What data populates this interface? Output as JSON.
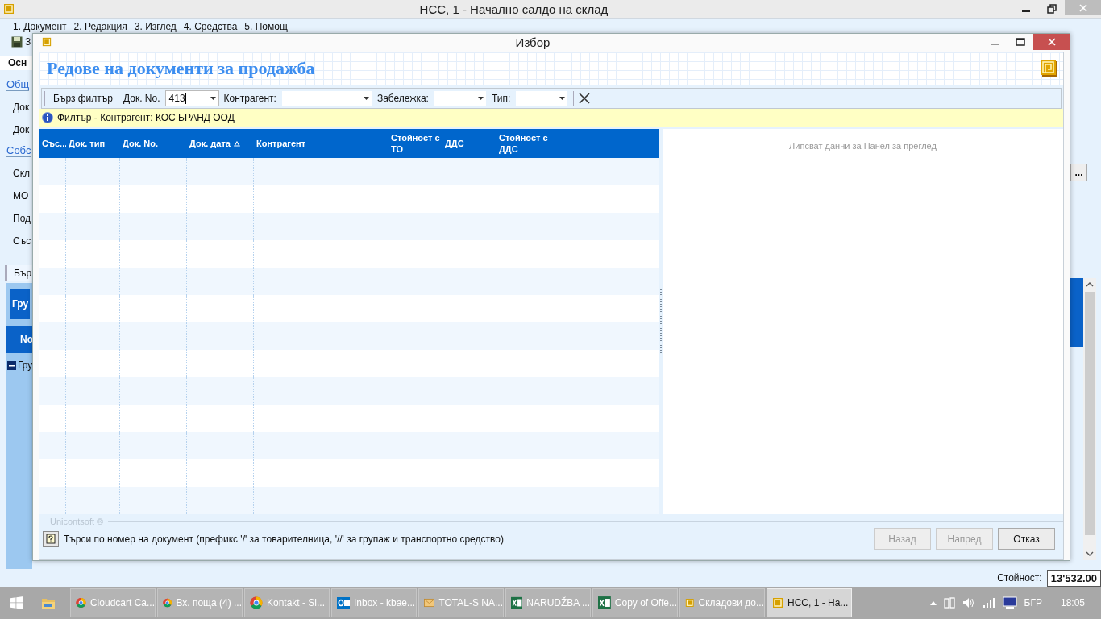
{
  "main_window": {
    "title": "НСС, 1 - Начално салдо на склад",
    "menu": [
      "1. Документ",
      "2. Редакция",
      "3. Изглед",
      "4. Средства",
      "5. Помощ"
    ],
    "toolbar_label": "З",
    "tab": "Осн",
    "sections": [
      {
        "title": "Общ",
        "fields": [
          "Док",
          "Док"
        ]
      },
      {
        "title": "Собс",
        "fields": [
          "Скл",
          "МО",
          "Под",
          "Със"
        ]
      }
    ],
    "quick_filter": "Бър",
    "group_panel": "Гру",
    "column_header": "No",
    "group_row": "Гру",
    "browse_button": "...",
    "total_label": "Стойност:",
    "total_value": "13'532.00"
  },
  "dialog": {
    "title": "Избор",
    "heading": "Редове на документи за продажба",
    "toolbar": {
      "quick_filter": "Бърз филтър",
      "fields": [
        {
          "label": "Док. No.",
          "value": "413"
        },
        {
          "label": "Контрагент:"
        },
        {
          "label": "Забележка:"
        },
        {
          "label": "Тип:"
        }
      ]
    },
    "filter_info": "Филтър - Контрагент: КОС БРАНД ООД",
    "table": {
      "columns": [
        {
          "label": "Със...",
          "sorted": false
        },
        {
          "label": "Док. тип",
          "sorted": false
        },
        {
          "label": "Док. No.",
          "sorted": false
        },
        {
          "label": "Док. дата",
          "sorted": true
        },
        {
          "label": "Контрагент",
          "sorted": false
        },
        {
          "label": "Стойност с ТО",
          "sorted": false
        },
        {
          "label": "ДДС",
          "sorted": false
        },
        {
          "label": "Стойност с ДДС",
          "sorted": false
        }
      ]
    },
    "preview": "Липсват данни за Панел за преглед",
    "brand": "Unicontsoft ®",
    "hint": "Търси по номер на документ (префикс '/' за товарителница, '//' за групаж и транспортно средство)",
    "buttons": [
      {
        "label": "Назад",
        "disabled": true
      },
      {
        "label": "Напред",
        "disabled": true
      },
      {
        "label": "Отказ",
        "disabled": false
      }
    ]
  },
  "taskbar": {
    "items": [
      {
        "label": "Cloudcart Ca...",
        "kind": "browser",
        "selected": false
      },
      {
        "label": "Вх. поща (4) ...",
        "kind": "browser",
        "selected": false
      },
      {
        "label": "Kontakt - Sl...",
        "kind": "browser",
        "selected": false
      },
      {
        "label": "Inbox - kbae...",
        "kind": "mailclient",
        "selected": false
      },
      {
        "label": "TOTAL-S NA...",
        "kind": "message",
        "selected": false
      },
      {
        "label": "NARUDŽBA ...",
        "kind": "spreadsheet",
        "selected": false
      },
      {
        "label": "Copy of Offe...",
        "kind": "spreadsheet",
        "selected": false
      },
      {
        "label": "Складови до...",
        "kind": "app",
        "selected": false
      },
      {
        "label": "НСС, 1 - На...",
        "kind": "app",
        "selected": true
      }
    ],
    "language": "БГР",
    "time": "18:05"
  }
}
